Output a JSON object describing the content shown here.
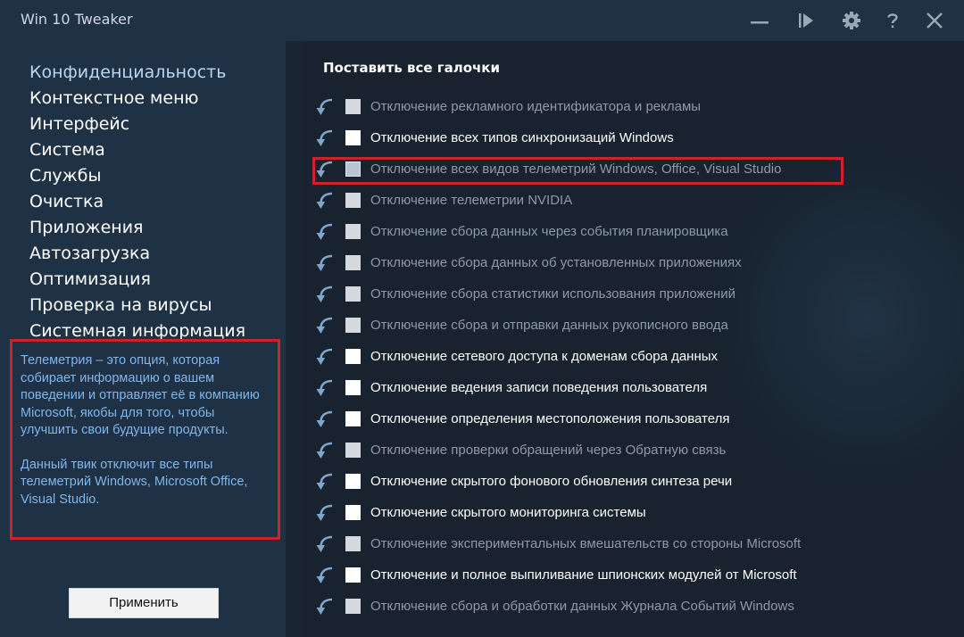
{
  "window": {
    "title": "Win 10 Tweaker",
    "controls": [
      "minimize-icon",
      "skip-icon",
      "gear-icon",
      "help-icon",
      "close-icon"
    ]
  },
  "sidebar": {
    "items": [
      {
        "label": "Конфиденциальность",
        "active": true
      },
      {
        "label": "Контекстное меню"
      },
      {
        "label": "Интерфейс"
      },
      {
        "label": "Система"
      },
      {
        "label": "Службы"
      },
      {
        "label": "Очистка"
      },
      {
        "label": "Приложения"
      },
      {
        "label": "Автозагрузка"
      },
      {
        "label": "Оптимизация"
      },
      {
        "label": "Проверка на вирусы"
      },
      {
        "label": "Системная информация"
      }
    ],
    "info": {
      "p1": "Телеметрия – это опция, которая собирает информацию о вашем поведении и отправляет её в компанию Microsoft, якобы для того, чтобы улучшить свои будущие продукты.",
      "p2": "Данный твик отключит все типы телеметрий Windows, Microsoft Office, Visual Studio."
    },
    "apply_label": "Применить"
  },
  "content": {
    "check_all_label": "Поставить все галочки",
    "tweaks": [
      {
        "label": "Отключение рекламного идентификатора и рекламы",
        "style": "dim"
      },
      {
        "label": "Отключение всех типов синхронизаций Windows",
        "style": "bright"
      },
      {
        "label": "Отключение всех видов телеметрий Windows, Office, Visual Studio",
        "style": "dim",
        "highlighted": true
      },
      {
        "label": "Отключение телеметрии NVIDIA",
        "style": "dim"
      },
      {
        "label": "Отключение сбора данных через события планировщика",
        "style": "dim"
      },
      {
        "label": "Отключение сбора данных об установленных приложениях",
        "style": "dim"
      },
      {
        "label": "Отключение сбора статистики использования приложений",
        "style": "dim"
      },
      {
        "label": "Отключение сбора и отправки данных рукописного ввода",
        "style": "dim"
      },
      {
        "label": "Отключение сетевого доступа к доменам сбора данных",
        "style": "bright"
      },
      {
        "label": "Отключение ведения записи поведения пользователя",
        "style": "bright"
      },
      {
        "label": "Отключение определения местоположения пользователя",
        "style": "bright"
      },
      {
        "label": "Отключение проверки обращений через Обратную связь",
        "style": "dim"
      },
      {
        "label": "Отключение скрытого фонового обновления синтеза речи",
        "style": "bright"
      },
      {
        "label": "Отключение скрытого мониторинга системы",
        "style": "bright"
      },
      {
        "label": "Отключение экспериментальных вмешательств со стороны Microsoft",
        "style": "dim"
      },
      {
        "label": "Отключение и полное выпиливание шпионских модулей от Microsoft",
        "style": "bright"
      },
      {
        "label": "Отключение сбора и обработки данных Журнала Событий Windows",
        "style": "dim"
      }
    ]
  },
  "colors": {
    "accent": "#7fb6ec",
    "highlight_border": "#d0202a",
    "background": "#1b2838"
  }
}
